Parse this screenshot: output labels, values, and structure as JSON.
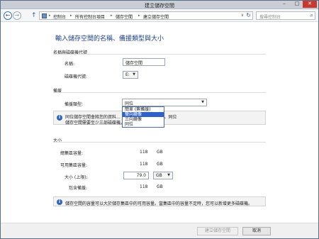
{
  "window": {
    "title": "建立儲存空間",
    "controls": {
      "minimize": "–",
      "maximize": "□",
      "close": "✕"
    }
  },
  "nav": {
    "back_glyph": "←",
    "forward_glyph": "→",
    "up_glyph": "↑",
    "breadcrumb": [
      "控制台",
      "所有控制台項目",
      "儲存空間",
      "建立儲存空間"
    ],
    "separator": "▸",
    "dropdown_glyph": "∨",
    "refresh_glyph": "↻",
    "search_placeholder": "搜尋控制台",
    "search_glyph": "⌕"
  },
  "main": {
    "heading": "輸入儲存空間的名稱、備援類型與大小",
    "name_section": {
      "title": "名稱與磁碟機代號",
      "name_label": "名稱:",
      "name_value": "儲存空間",
      "drive_label": "磁碟機代號:",
      "drive_value": "E:"
    },
    "resiliency_section": {
      "title": "備援",
      "type_label": "備援類型:",
      "type_value": "同位",
      "dropdown_options": [
        "簡單 (無備援)",
        "雙向鏡像",
        "三向鏡像",
        "同位"
      ],
      "selected_index": 1,
      "info_line1": "同位儲存空間會將您的資料...                                     ...您的資料也不會遺失。同位",
      "info_line2": "儲存空間需要至少三部磁碟機。"
    },
    "size_section": {
      "title": "大小",
      "total_label": "總集區容量:",
      "total_value": "118",
      "total_unit": "GB",
      "available_label": "可用集區容量:",
      "available_value": "118",
      "available_unit": "GB",
      "size_label": "大小 (上限):",
      "size_value": "79.0",
      "size_unit": "GB",
      "including_label": "包含備援:",
      "including_value": "118",
      "including_unit": "GB",
      "info_text": "儲存空間的容量可以大於儲存集區中的可用容量。當集區中的容量不足時，您可以新增更多磁碟機。"
    }
  },
  "footer": {
    "create_label": "建立儲存空間",
    "cancel_label": "取消"
  },
  "colors": {
    "heading": "#1e3f8a",
    "selection": "#2f62c8",
    "info_icon": "#2f66b3"
  }
}
